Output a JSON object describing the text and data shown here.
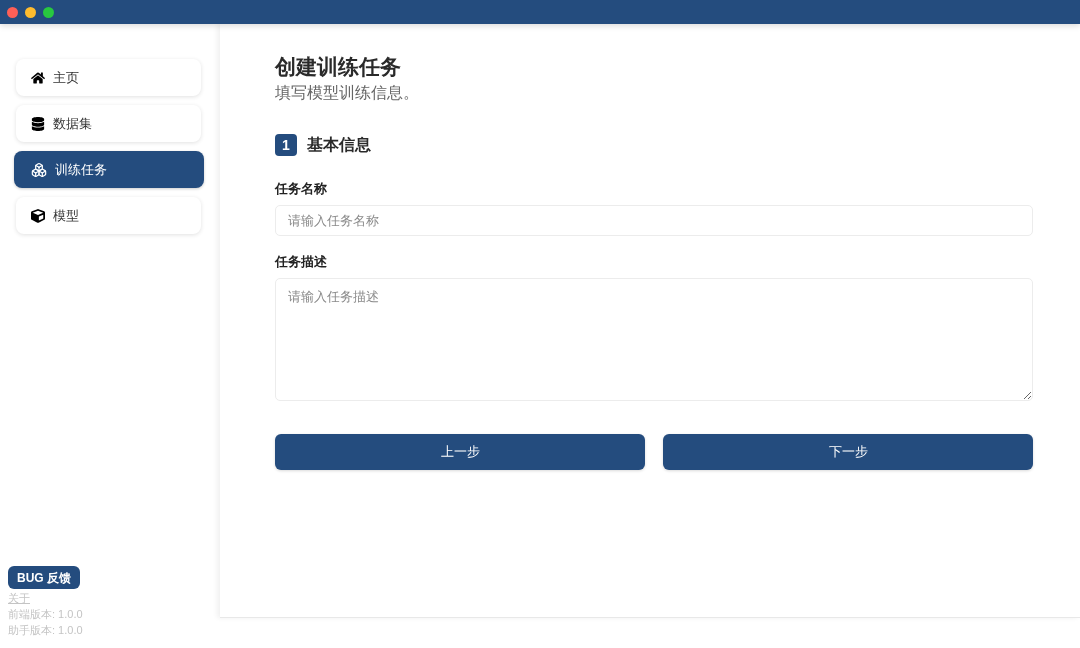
{
  "sidebar": {
    "items": [
      {
        "label": "主页",
        "selected": false
      },
      {
        "label": "数据集",
        "selected": false
      },
      {
        "label": "训练任务",
        "selected": true
      },
      {
        "label": "模型",
        "selected": false
      }
    ],
    "feedback_button": "BUG 反馈",
    "about_link": "关于",
    "versions": [
      "前端版本: 1.0.0",
      "助手版本: 1.0.0"
    ]
  },
  "main": {
    "title": "创建训练任务",
    "subtitle": "填写模型训练信息。",
    "step": {
      "number": "1",
      "title": "基本信息"
    },
    "fields": [
      {
        "kind": "input",
        "label": "任务名称",
        "placeholder": "请输入任务名称"
      },
      {
        "kind": "textarea",
        "label": "任务描述",
        "placeholder": "请输入任务描述"
      }
    ],
    "buttons": [
      "上一步",
      "下一步"
    ]
  }
}
